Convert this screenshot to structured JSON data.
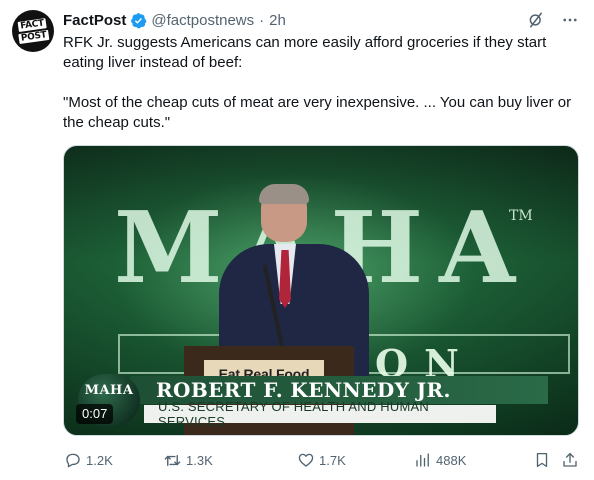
{
  "author": {
    "name": "FactPost",
    "handle": "@factpostnews",
    "separator": "·",
    "time": "2h",
    "avatar_text": [
      "FACT",
      "POST"
    ]
  },
  "icons": {
    "verified": "verified-badge-icon",
    "grok": "grok-icon",
    "more": "more-icon"
  },
  "tweet": {
    "paragraphs": [
      "RFK Jr. suggests Americans can more easily afford groceries if they start eating liver instead of beef:",
      "\"Most of the cheap cuts of meat are very inexpensive. ... You can buy liver or the cheap cuts.\""
    ]
  },
  "media": {
    "backdrop_letters": "MAHA",
    "backdrop_tm": "TM",
    "backdrop_sub": "ON",
    "podium_sign": "Eat Real Food",
    "lower_third_logo": "MAHA",
    "lower_third_name": "ROBERT F. KENNEDY JR.",
    "lower_third_title": "U.S. SECRETARY OF HEALTH AND HUMAN SERVICES",
    "duration": "0:07"
  },
  "actions": {
    "replies": "1.2K",
    "reposts": "1.3K",
    "likes": "1.7K",
    "views": "488K"
  },
  "colors": {
    "text": "#0f1419",
    "muted": "#536471",
    "verified": "#1d9bf0"
  }
}
